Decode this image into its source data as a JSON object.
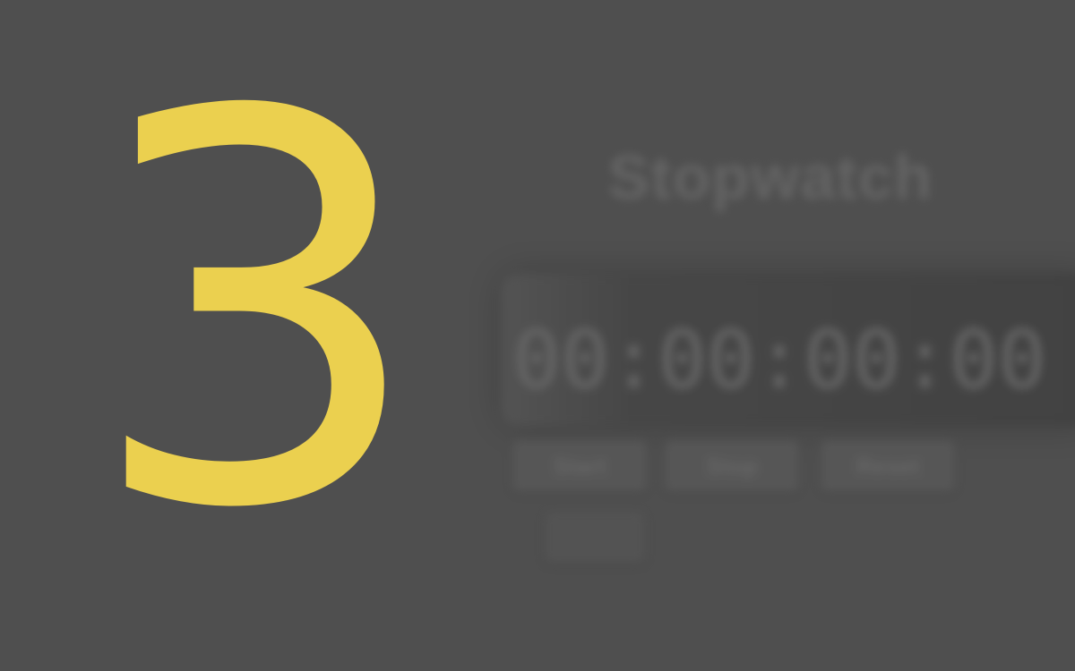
{
  "app": {
    "title": "Stopwatch",
    "time": "00:00:00:00",
    "buttons": {
      "start": "Start",
      "stop": "Stop",
      "reset": "Reset",
      "extra": ""
    }
  },
  "countdown": {
    "value": "3",
    "color": "#ebd04f"
  },
  "colors": {
    "background": "#4f4f4f",
    "panel": "#3e3e3e"
  }
}
